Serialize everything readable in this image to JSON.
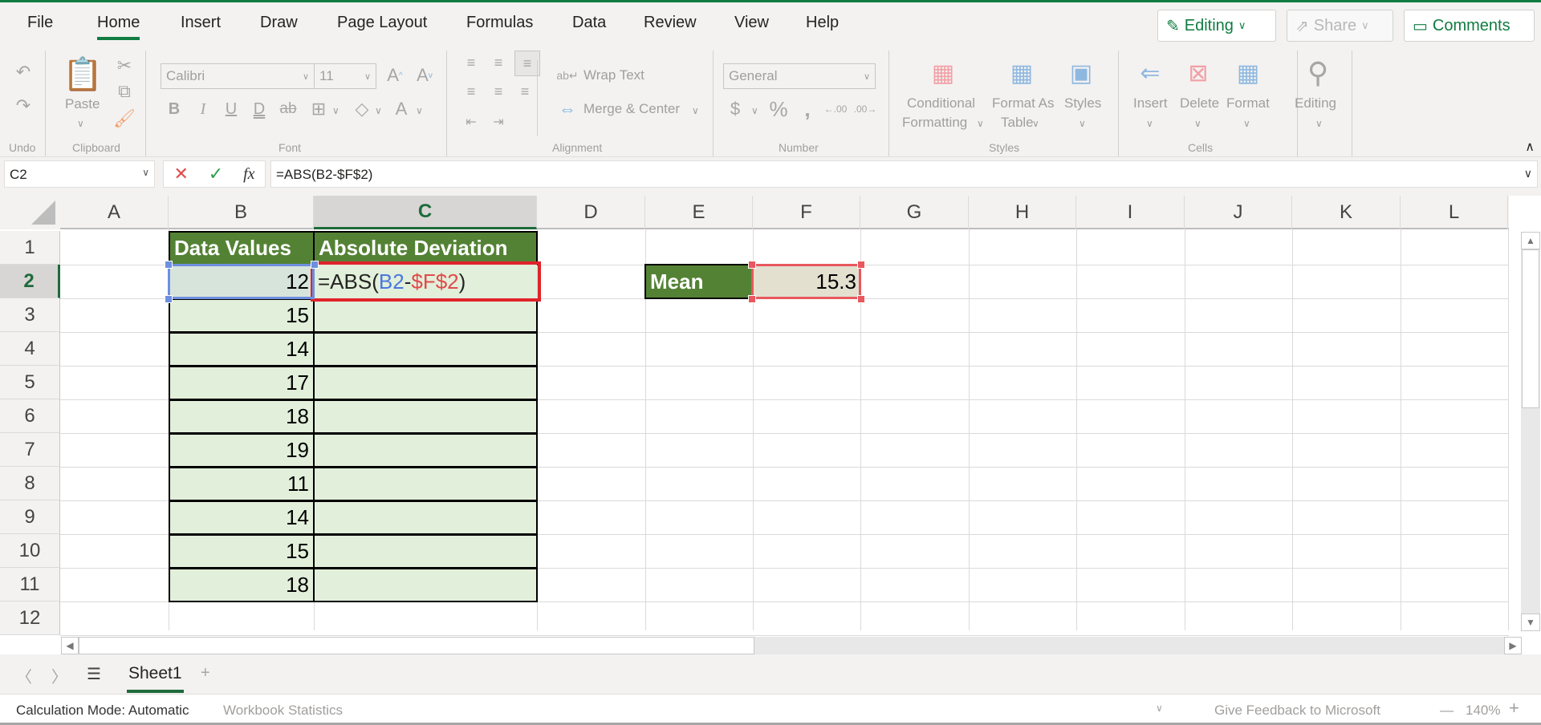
{
  "ribbon_tabs": [
    "File",
    "Home",
    "Insert",
    "Draw",
    "Page Layout",
    "Formulas",
    "Data",
    "Review",
    "View",
    "Help"
  ],
  "active_tab": "Home",
  "top_buttons": {
    "editing": "Editing",
    "share": "Share",
    "comments": "Comments"
  },
  "ribbon": {
    "undo_label": "Undo",
    "clipboard": {
      "paste": "Paste",
      "label": "Clipboard"
    },
    "font": {
      "name": "Calibri",
      "size": "11",
      "label": "Font"
    },
    "alignment": {
      "wrap_text": "Wrap Text",
      "merge_center": "Merge & Center",
      "label": "Alignment"
    },
    "number": {
      "format": "General",
      "label": "Number"
    },
    "styles": {
      "conditional_1": "Conditional",
      "conditional_2": "Formatting",
      "format_as_1": "Format As",
      "format_as_2": "Table",
      "styles": "Styles",
      "label": "Styles"
    },
    "cells": {
      "insert": "Insert",
      "delete": "Delete",
      "format": "Format",
      "label": "Cells"
    },
    "editing": {
      "editing": "Editing"
    }
  },
  "formula_bar": {
    "name_box": "C2",
    "formula": "=ABS(B2-$F$2)"
  },
  "columns": [
    "A",
    "B",
    "C",
    "D",
    "E",
    "F",
    "G",
    "H",
    "I",
    "J",
    "K",
    "L"
  ],
  "selected_column": "C",
  "rows": [
    "1",
    "2",
    "3",
    "4",
    "5",
    "6",
    "7",
    "8",
    "9",
    "10",
    "11",
    "12"
  ],
  "selected_row": "2",
  "sheet": {
    "header_b": "Data Values",
    "header_c": "Absolute Deviation",
    "data_values": [
      "12",
      "15",
      "14",
      "17",
      "18",
      "19",
      "11",
      "14",
      "15",
      "18"
    ],
    "editing_formula": {
      "prefix": "=ABS(",
      "ref1": "B2",
      "minus": "-",
      "ref2": "$F$2",
      "suffix": ")"
    },
    "mean_label": "Mean",
    "mean_value": "15.3"
  },
  "sheet_tabs": {
    "active": "Sheet1"
  },
  "status_bar": {
    "calc_mode": "Calculation Mode: Automatic",
    "workbook_stats": "Workbook Statistics",
    "feedback": "Give Feedback to Microsoft",
    "zoom": "140%"
  },
  "colors": {
    "accent": "#107c41",
    "header_fill": "#548235",
    "data_fill": "#e2efda",
    "ref_blue": "#4a78e0",
    "ref_red": "#e04b4b"
  }
}
